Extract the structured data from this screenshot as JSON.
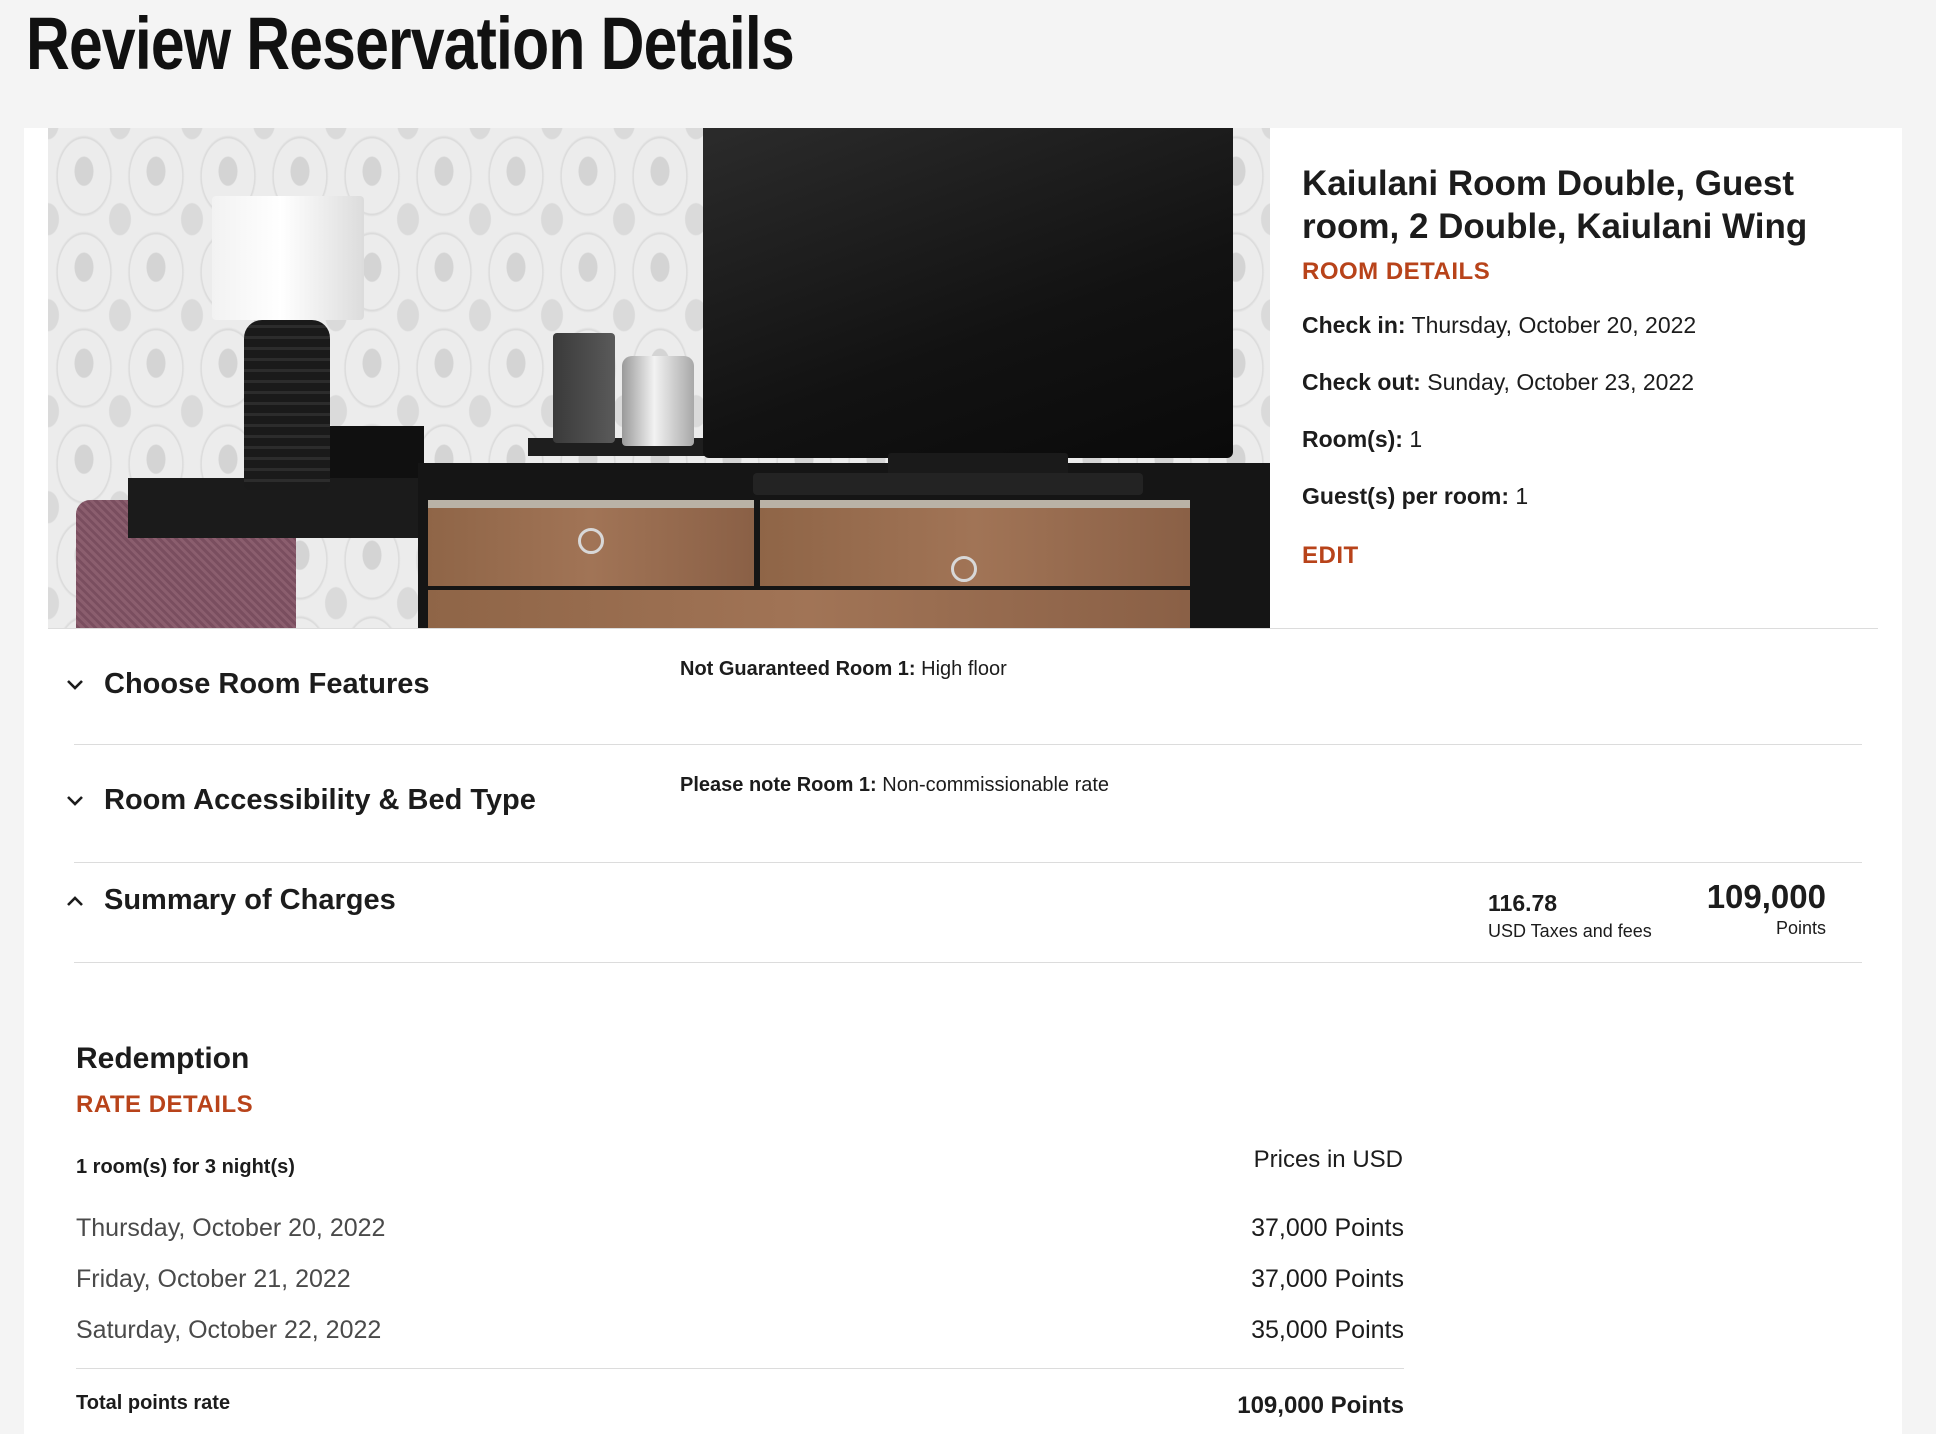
{
  "page": {
    "title": "Review Reservation Details"
  },
  "room": {
    "name": "Kaiulani Room Double, Guest room, 2 Double, Kaiulani Wing",
    "details_link": "ROOM DETAILS",
    "check_in_label": "Check in:",
    "check_in_value": "Thursday, October 20, 2022",
    "check_out_label": "Check out:",
    "check_out_value": "Sunday, October 23, 2022",
    "rooms_label": "Room(s):",
    "rooms_value": "1",
    "guests_label": "Guest(s) per room:",
    "guests_value": "1",
    "edit_link": "EDIT"
  },
  "sections": {
    "features": {
      "label": "Choose Room Features",
      "note_label": "Not Guaranteed Room 1:",
      "note_value": "High floor"
    },
    "accessibility": {
      "label": "Room Accessibility & Bed Type",
      "note_label": "Please note Room 1:",
      "note_value": "Non-commissionable rate"
    },
    "summary": {
      "label": "Summary of Charges",
      "taxes_amount": "116.78",
      "taxes_label": "USD Taxes and fees",
      "points_amount": "109,000",
      "points_label": "Points"
    }
  },
  "redemption": {
    "title": "Redemption",
    "rate_details_link": "RATE DETAILS",
    "nights_text": "1 room(s) for 3 night(s)",
    "prices_in": "Prices in USD",
    "rows": [
      {
        "date": "Thursday, October 20, 2022",
        "points": "37,000 Points"
      },
      {
        "date": "Friday, October 21, 2022",
        "points": "37,000 Points"
      },
      {
        "date": "Saturday, October 22, 2022",
        "points": "35,000 Points"
      }
    ],
    "total_label": "Total points rate",
    "total_value": "109,000 Points"
  },
  "colors": {
    "accent": "#b8431a",
    "background": "#f4f4f4",
    "text": "#1c1c1c"
  },
  "icons": {
    "collapsed": "chevron-down-icon",
    "expanded": "chevron-up-icon"
  }
}
